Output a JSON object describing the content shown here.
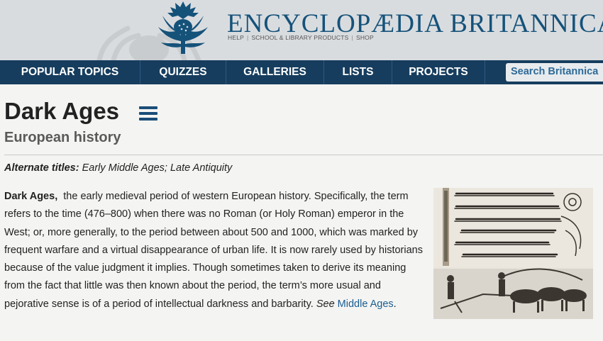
{
  "header": {
    "brand": "ENCYCLOPÆDIA BRITANNICA",
    "util_links": [
      "HELP",
      "SCHOOL & LIBRARY PRODUCTS",
      "SHOP"
    ]
  },
  "nav": {
    "items": [
      "POPULAR TOPICS",
      "QUIZZES",
      "GALLERIES",
      "LISTS",
      "PROJECTS"
    ],
    "search_placeholder": "Search Britannica"
  },
  "article": {
    "title": "Dark Ages",
    "subtitle": "European history",
    "alt_label": "Alternate titles:",
    "alt_titles": "Early Middle Ages; Late Antiquity",
    "lead_term": "Dark Ages,",
    "body": "the early medieval period of western European history. Specifically, the term refers to the time (476–800) when there was no Roman (or Holy Roman) emperor in the West; or, more generally, to the period between about 500 and 1000, which was marked by frequent warfare and a virtual disappearance of urban life. It is now rarely used by historians because of the value judgment it implies. Though sometimes taken to derive its meaning from the fact that little was then known about the period, the term’s more usual and pejorative sense is of a period of intellectual darkness and barbarity.",
    "see_label": "See",
    "see_link": "Middle Ages",
    "end_punct": "."
  },
  "colors": {
    "nav_bg": "#163d5e",
    "brand": "#15527a",
    "link": "#1a5d91"
  }
}
